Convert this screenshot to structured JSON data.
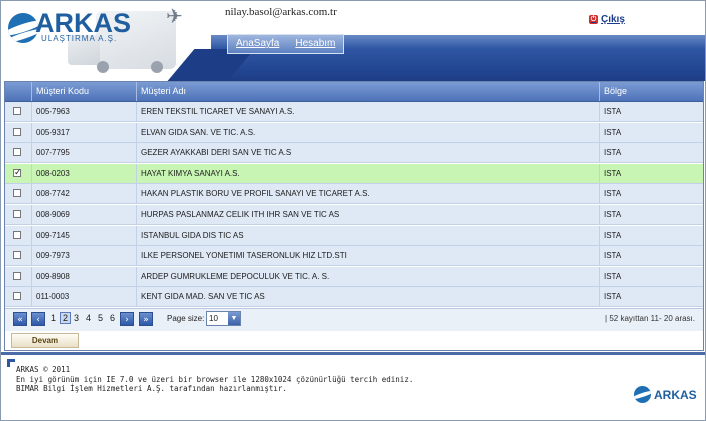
{
  "header": {
    "logo_main": "ARKAS",
    "logo_sub": "ULAŞTIRMA A.Ş.",
    "user_email": "nilay.basol@arkas.com.tr",
    "logout_label": "Çıkış",
    "nav": [
      {
        "label": "AnaSayfa"
      },
      {
        "label": "Hesabım"
      }
    ]
  },
  "grid": {
    "columns": [
      "Müşteri Kodu",
      "Müşteri Adı",
      "Bölge"
    ],
    "rows": [
      {
        "checked": false,
        "code": "005-7963",
        "name": "EREN TEKSTIL TICARET VE SANAYI A.S.",
        "region": "ISTA"
      },
      {
        "checked": false,
        "code": "005-9317",
        "name": "ELVAN GIDA SAN. VE TIC. A.S.",
        "region": "ISTA"
      },
      {
        "checked": false,
        "code": "007-7795",
        "name": "GEZER AYAKKABI DERI SAN VE TIC A.S",
        "region": "ISTA"
      },
      {
        "checked": true,
        "code": "008-0203",
        "name": "HAYAT KIMYA SANAYI A.S.",
        "region": "ISTA"
      },
      {
        "checked": false,
        "code": "008-7742",
        "name": "HAKAN PLASTIK BORU VE PROFIL SANAYI VE TICARET A.S.",
        "region": "ISTA"
      },
      {
        "checked": false,
        "code": "008-9069",
        "name": "HURPAS PASLANMAZ CELIK ITH IHR SAN VE TIC AS",
        "region": "ISTA"
      },
      {
        "checked": false,
        "code": "009-7145",
        "name": "ISTANBUL GIDA DIS TIC AS",
        "region": "ISTA"
      },
      {
        "checked": false,
        "code": "009-7973",
        "name": "ILKE PERSONEL YONETIMI TASERONLUK HIZ LTD.STI",
        "region": "ISTA"
      },
      {
        "checked": false,
        "code": "009-8908",
        "name": "ARDEP GUMRUKLEME DEPOCULUK VE TIC. A. S.",
        "region": "ISTA"
      },
      {
        "checked": false,
        "code": "011-0003",
        "name": "KENT GIDA MAD. SAN VE TIC AS",
        "region": "ISTA"
      }
    ]
  },
  "pager": {
    "pages": [
      "1",
      "2",
      "3",
      "4",
      "5",
      "6"
    ],
    "current_page": "2",
    "page_size_label": "Page size:",
    "page_size_value": "10",
    "summary": "| 52 kayıttan 11- 20 arası."
  },
  "actions": {
    "continue_label": "Devam"
  },
  "footer": {
    "line1": "ARKAS © 2011",
    "line2": "En iyi görünüm için IE 7.0 ve üzeri bir browser ile 1280x1024 çözünürlüğü tercih ediniz.",
    "line3": "BIMAR Bilgi İşlem Hizmetleri A.Ş. tarafından hazırlanmıştır.",
    "logo_text": "ARKAS"
  },
  "colors": {
    "brand_blue": "#1f5f9f",
    "header_band": "#2f56a4",
    "row_bg": "#dfe9f6",
    "selected_row_bg": "#c8f5b3"
  }
}
